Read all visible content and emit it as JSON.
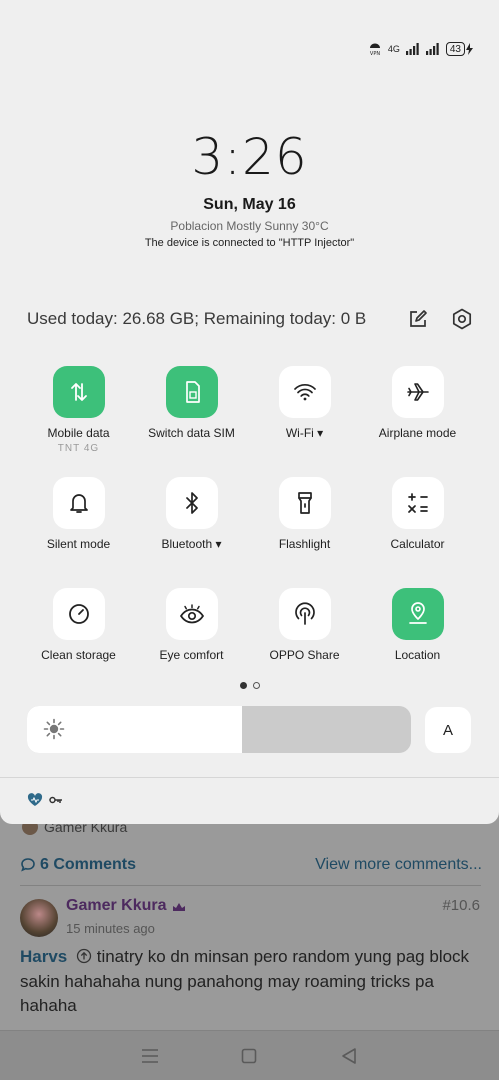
{
  "status_bar": {
    "network_label": "4G",
    "battery_level": "43"
  },
  "lock_info": {
    "time": "3:26",
    "date": "Sun, May 16",
    "weather": "Poblacion Mostly Sunny 30°C",
    "connection_notice": "The device is connected to \"HTTP Injector\""
  },
  "data_usage": {
    "text": "Used today: 26.68 GB; Remaining today: 0 B"
  },
  "tiles": [
    {
      "label": "Mobile data",
      "sub": "TNT  4G",
      "active": true,
      "icon": "mobile-data-icon"
    },
    {
      "label": "Switch data SIM",
      "active": true,
      "icon": "sim-card-icon"
    },
    {
      "label": "Wi-Fi ▾",
      "active": false,
      "icon": "wifi-icon"
    },
    {
      "label": "Airplane mode",
      "active": false,
      "icon": "airplane-icon"
    },
    {
      "label": "Silent mode",
      "active": false,
      "icon": "bell-icon"
    },
    {
      "label": "Bluetooth ▾",
      "active": false,
      "icon": "bluetooth-icon"
    },
    {
      "label": "Flashlight",
      "active": false,
      "icon": "flashlight-icon"
    },
    {
      "label": "Calculator",
      "active": false,
      "icon": "calculator-icon"
    },
    {
      "label": "Clean storage",
      "active": false,
      "icon": "clean-storage-icon"
    },
    {
      "label": "Eye comfort",
      "active": false,
      "icon": "eye-icon"
    },
    {
      "label": "OPPO Share",
      "active": false,
      "icon": "share-icon"
    },
    {
      "label": "Location",
      "active": true,
      "icon": "location-icon"
    }
  ],
  "pager": {
    "page": 1,
    "total": 2
  },
  "brightness": {
    "level": 0.56,
    "auto_label": "A"
  },
  "colors": {
    "accent": "#3dc07a",
    "panel": "#efefef",
    "tile": "#ffffff"
  },
  "background_app": {
    "top_author": "Gamer Kkura",
    "comments_count": "6 Comments",
    "view_more": "View more comments...",
    "comment_author": "Gamer Kkura",
    "comment_time": "15 minutes ago",
    "comment_number": "#10.6",
    "mention": "Harvs",
    "comment_body": " tinatry ko dn minsan pero random yung pag block sakin hahahaha nung panahong may roaming tricks pa hahaha"
  }
}
